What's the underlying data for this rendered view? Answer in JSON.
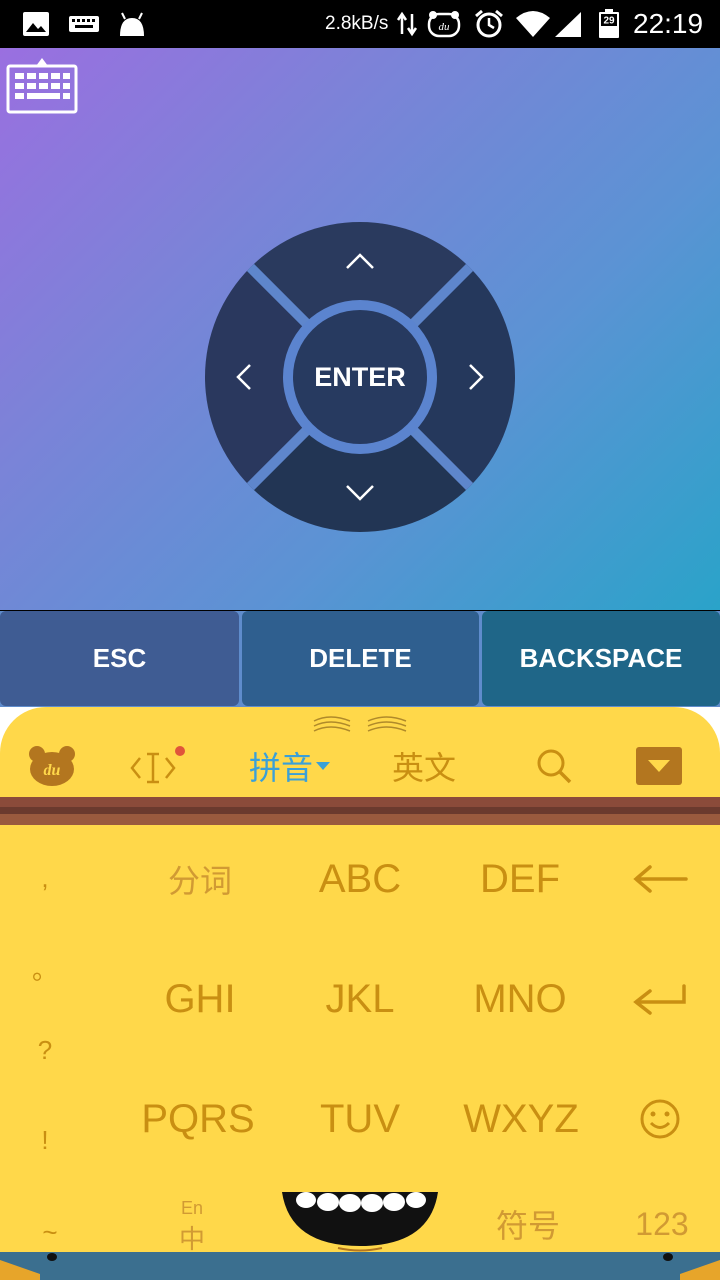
{
  "status_bar": {
    "net_speed": "2.8kB/s",
    "battery_level": "29",
    "time": "22:19",
    "icons": [
      "image-icon",
      "keyboard-icon",
      "android-icon",
      "data-arrows-icon",
      "du-icon",
      "alarm-icon",
      "wifi-icon",
      "signal-icon",
      "battery-icon"
    ]
  },
  "remote": {
    "keyboard_toggle_icon": "keyboard-icon",
    "dpad": {
      "enter_label": "ENTER",
      "up_icon": "chevron-up-icon",
      "down_icon": "chevron-down-icon",
      "left_icon": "chevron-left-icon",
      "right_icon": "chevron-right-icon"
    },
    "buttons": {
      "esc": "ESC",
      "delete": "DELETE",
      "backspace": "BACKSPACE"
    }
  },
  "ime": {
    "toolbar": {
      "logo_icon": "du-bear-icon",
      "cursor_icon": "cursor-move-icon",
      "pinyin": "拼音",
      "english": "英文",
      "search_icon": "search-icon",
      "collapse_icon": "collapse-icon"
    },
    "punctuation": [
      ",",
      "。",
      "?",
      "!",
      "~"
    ],
    "keys": {
      "row1": [
        "分词",
        "ABC",
        "DEF"
      ],
      "row2": [
        "GHI",
        "JKL",
        "MNO"
      ],
      "row3": [
        "PQRS",
        "TUV",
        "WXYZ"
      ],
      "lang_top": "En",
      "lang_bottom": "中",
      "symbols": "符号",
      "numbers": "123"
    },
    "colors": {
      "background": "#ffd84a",
      "key_text": "#c98f12",
      "accent": "#3aa0d8"
    }
  }
}
